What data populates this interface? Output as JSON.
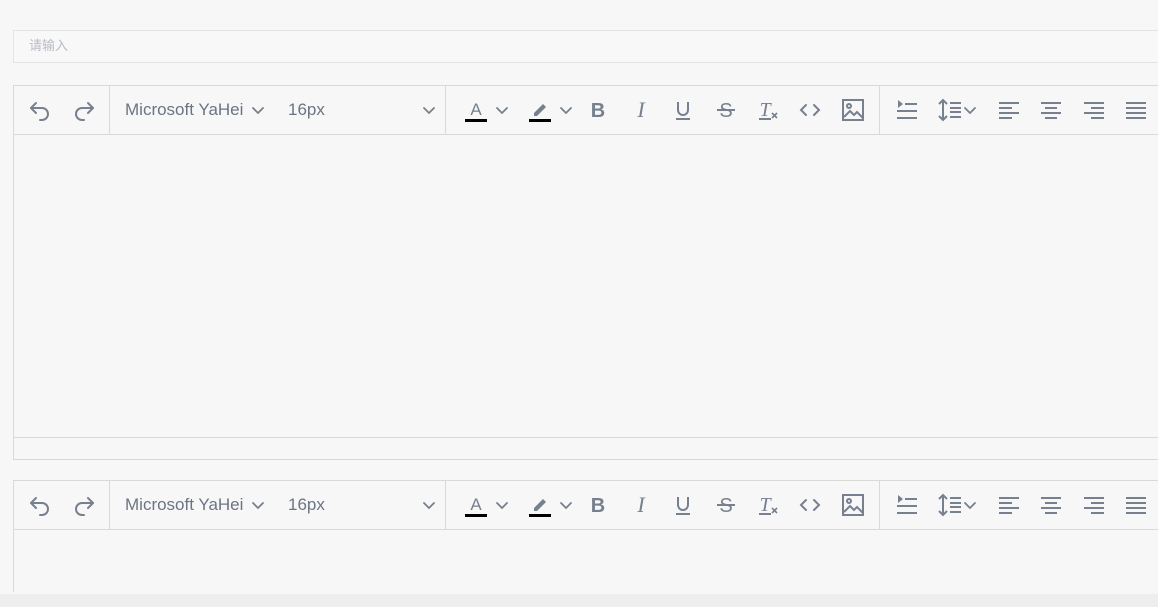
{
  "search": {
    "placeholder": "请输入"
  },
  "editors": [
    {
      "font_family": "Microsoft YaHei",
      "font_size": "16px"
    },
    {
      "font_family": "Microsoft YaHei",
      "font_size": "16px"
    }
  ],
  "colors": {
    "icon": "#77808e",
    "border": "#d9d9d9",
    "text_color_bar": "#000000"
  },
  "icons": [
    "undo-icon",
    "redo-icon",
    "font-color-icon",
    "highlight-icon",
    "bold-icon",
    "italic-icon",
    "underline-icon",
    "strikethrough-icon",
    "clear-format-icon",
    "code-icon",
    "image-icon",
    "indent-icon",
    "line-height-icon",
    "align-left-icon",
    "align-center-icon",
    "align-right-icon",
    "align-justify-icon"
  ]
}
